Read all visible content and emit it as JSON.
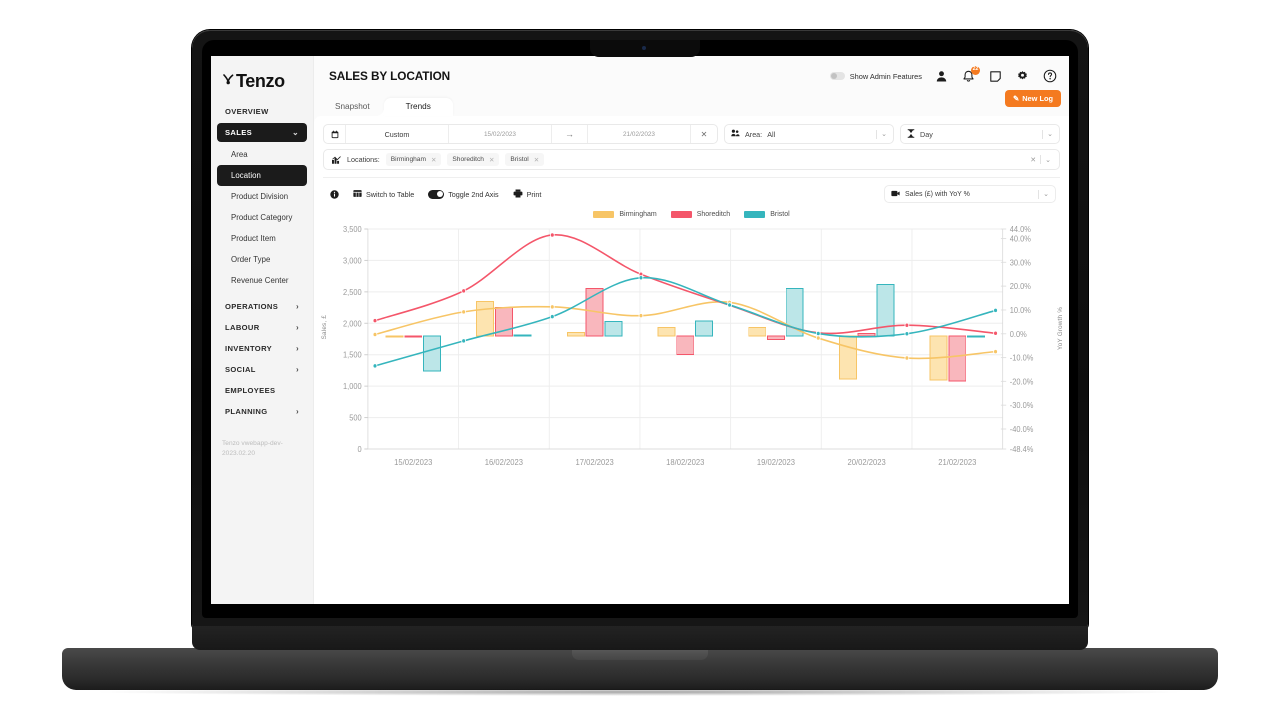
{
  "brand": {
    "name": "Tenzo",
    "accent": "#f47a20"
  },
  "sidebar": {
    "overview_label": "OVERVIEW",
    "sales_section": "SALES",
    "items": [
      {
        "label": "Area"
      },
      {
        "label": "Location"
      },
      {
        "label": "Product Division"
      },
      {
        "label": "Product Category"
      },
      {
        "label": "Product Item"
      },
      {
        "label": "Order Type"
      },
      {
        "label": "Revenue Center"
      }
    ],
    "sections": [
      {
        "label": "OPERATIONS",
        "chevron": "›"
      },
      {
        "label": "LABOUR",
        "chevron": "›"
      },
      {
        "label": "INVENTORY",
        "chevron": "›"
      },
      {
        "label": "SOCIAL",
        "chevron": "›"
      },
      {
        "label": "EMPLOYEES",
        "chevron": ""
      },
      {
        "label": "PLANNING",
        "chevron": "›"
      }
    ],
    "build": "Tenzo vwebapp-dev-2023.02.20"
  },
  "header": {
    "title": "SALES BY LOCATION",
    "admin_toggle_label": "Show Admin Features",
    "notification_count": "22",
    "icons": [
      "user-icon",
      "bell-icon",
      "note-icon",
      "gear-icon",
      "help-icon"
    ]
  },
  "tabs": [
    {
      "label": "Snapshot",
      "active": false
    },
    {
      "label": "Trends",
      "active": true
    }
  ],
  "new_log_button": "New Log",
  "filters": {
    "range_preset": "Custom",
    "start_date": "15/02/2023",
    "end_date": "21/02/2023",
    "arrow": "→",
    "clear": "✕",
    "area_label": "Area:",
    "area_value": "All",
    "granularity": "Day",
    "locations_label": "Locations:",
    "locations": [
      "Birmingham",
      "Shoreditch",
      "Bristol"
    ],
    "chip_remove": "✕"
  },
  "chart_toolbar": {
    "info": "i",
    "switch_to_table": "Switch to Table",
    "toggle_2nd_axis": "Toggle 2nd Axis",
    "print": "Print",
    "metric": "Sales (£) with YoY %"
  },
  "chart_data": {
    "type": "bar",
    "title": "",
    "xlabel": "",
    "ylabel": "Sales, £",
    "y2label": "YoY Growth %",
    "grid": true,
    "legend_position": "top-center",
    "categories": [
      "15/02/2023",
      "16/02/2023",
      "17/02/2023",
      "18/02/2023",
      "19/02/2023",
      "20/02/2023",
      "21/02/2023"
    ],
    "ylim": [
      0,
      3500
    ],
    "yticks": [
      "0",
      "500",
      "1,000",
      "1,500",
      "2,000",
      "2,500",
      "3,000",
      "3,500"
    ],
    "ytick_values": [
      0,
      500,
      1000,
      1500,
      2000,
      2500,
      3000,
      3500
    ],
    "y2lim": [
      -48.4,
      44.0
    ],
    "y2ticks": [
      "-48.4%",
      "-40.0%",
      "-30.0%",
      "-20.0%",
      "-10.0%",
      "0.0%",
      "10.0%",
      "20.0%",
      "30.0%",
      "40.0%",
      "44.0%"
    ],
    "y2tick_values": [
      -48.4,
      -40,
      -30,
      -20,
      -10,
      0,
      10,
      20,
      30,
      40,
      44
    ],
    "bar_baseline": 1800,
    "series": [
      {
        "name": "Birmingham",
        "color": "#f7c566",
        "bar_color": "#fde4b0",
        "bars": [
          1790,
          2350,
          1850,
          1930,
          1935,
          1115,
          1100
        ],
        "line_yoy": [
          -0.3,
          9.2,
          11.3,
          7.6,
          13.2,
          -1.8,
          -10.2,
          -7.5
        ]
      },
      {
        "name": "Shoreditch",
        "color": "#f4566a",
        "bar_color": "#f9b7bd",
        "bars": [
          1800,
          2255,
          2555,
          1500,
          1740,
          1835,
          1080
        ],
        "line_yoy": [
          5.5,
          18.0,
          41.5,
          25.0,
          12.0,
          0.4,
          3.6,
          0.2
        ]
      },
      {
        "name": "Bristol",
        "color": "#35b5bd",
        "bar_color": "#bce6e8",
        "bars": [
          1240,
          1815,
          2030,
          2035,
          2550,
          2620,
          1795
        ],
        "line_yoy": [
          -13.5,
          -3.0,
          7.2,
          23.5,
          12.1,
          0.1,
          0.0,
          9.8
        ]
      }
    ]
  }
}
